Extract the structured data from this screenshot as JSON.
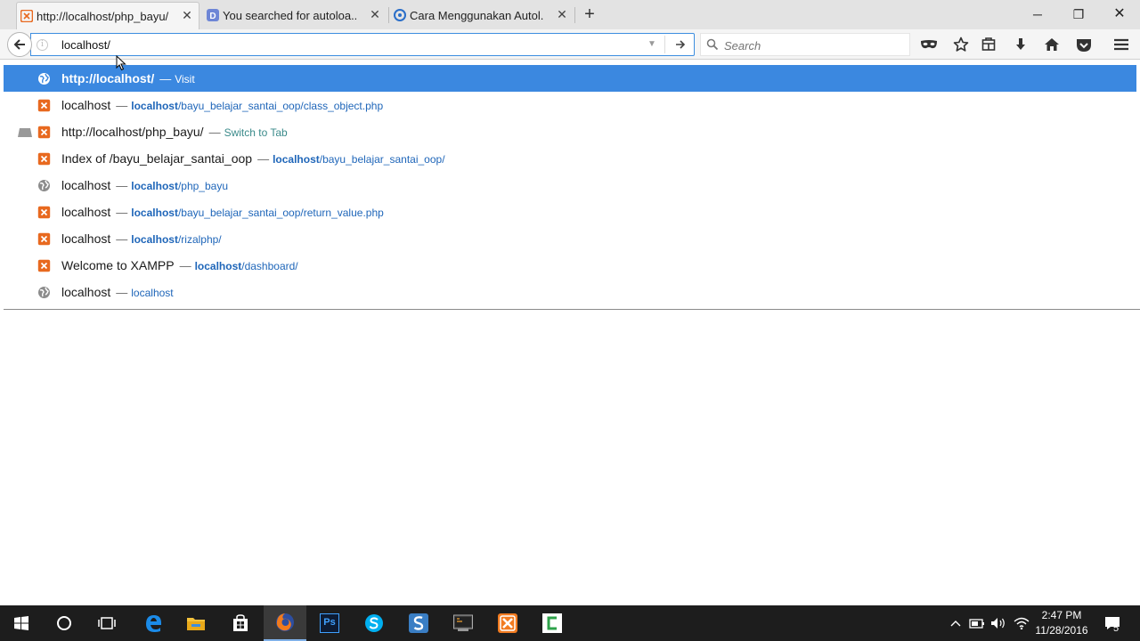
{
  "tabs": [
    {
      "title": "http://localhost/php_bayu/",
      "icon": "xampp-icon",
      "active": true
    },
    {
      "title": "You searched for autoloa...",
      "icon": "d-icon",
      "active": false
    },
    {
      "title": "Cara Menggunakan Autol...",
      "icon": "c-icon",
      "active": false
    }
  ],
  "window_controls": {
    "minimize": "─",
    "restore": "❐",
    "close": "✕"
  },
  "address_bar": {
    "value": "localhost/"
  },
  "search_bar": {
    "placeholder": "Search"
  },
  "toolbar_icons": [
    "mask-icon",
    "star-icon",
    "reading-list-icon",
    "download-icon",
    "home-icon",
    "pocket-icon",
    "menu-icon"
  ],
  "autocomplete": [
    {
      "icon": "globe-icon",
      "title_bold": "http://localhost/",
      "title_rest": "",
      "action": "Visit",
      "url_bold": "",
      "url_rest": "",
      "selected": true,
      "tab": false
    },
    {
      "icon": "xampp-icon",
      "title_bold": "",
      "title_rest": "localhost",
      "action": "",
      "url_bold": "localhost",
      "url_rest": "/bayu_belajar_santai_oop/class_object.php",
      "selected": false,
      "tab": false
    },
    {
      "icon": "xampp-icon",
      "title_bold": "",
      "title_rest": "http://localhost/php_bayu/",
      "action": "Switch to Tab",
      "url_bold": "",
      "url_rest": "",
      "selected": false,
      "tab": true
    },
    {
      "icon": "xampp-icon",
      "title_bold": "",
      "title_rest": "Index of /bayu_belajar_santai_oop",
      "action": "",
      "url_bold": "localhost",
      "url_rest": "/bayu_belajar_santai_oop/",
      "selected": false,
      "tab": false
    },
    {
      "icon": "globe-gray-icon",
      "title_bold": "",
      "title_rest": "localhost",
      "action": "",
      "url_bold": "localhost",
      "url_rest": "/php_bayu",
      "selected": false,
      "tab": false
    },
    {
      "icon": "xampp-icon",
      "title_bold": "",
      "title_rest": "localhost",
      "action": "",
      "url_bold": "localhost",
      "url_rest": "/bayu_belajar_santai_oop/return_value.php",
      "selected": false,
      "tab": false
    },
    {
      "icon": "xampp-icon",
      "title_bold": "",
      "title_rest": "localhost",
      "action": "",
      "url_bold": "localhost",
      "url_rest": "/rizalphp/",
      "selected": false,
      "tab": false
    },
    {
      "icon": "xampp-icon",
      "title_bold": "",
      "title_rest": "Welcome to XAMPP",
      "action": "",
      "url_bold": "localhost",
      "url_rest": "/dashboard/",
      "selected": false,
      "tab": false
    },
    {
      "icon": "globe-gray-icon",
      "title_bold": "",
      "title_rest": "localhost",
      "action": "",
      "url_bold": "",
      "url_rest": "localhost",
      "selected": false,
      "tab": false
    }
  ],
  "dash": "—",
  "taskbar": {
    "apps": [
      "start-icon",
      "cortana-icon",
      "task-view-icon",
      "edge-icon",
      "file-explorer-icon",
      "store-icon",
      "firefox-icon",
      "photoshop-icon",
      "skype-icon",
      "sublime-icon",
      "terminal-icon",
      "xampp-icon",
      "camtasia-icon"
    ],
    "photoshop_label": "Ps",
    "time": "2:47 PM",
    "date": "11/28/2016",
    "notification_count": "5"
  },
  "colors": {
    "selection": "#3b88e0",
    "url_blue": "#1f66b9",
    "xampp_orange": "#e8691f",
    "taskbar": "#1d1d1d"
  }
}
